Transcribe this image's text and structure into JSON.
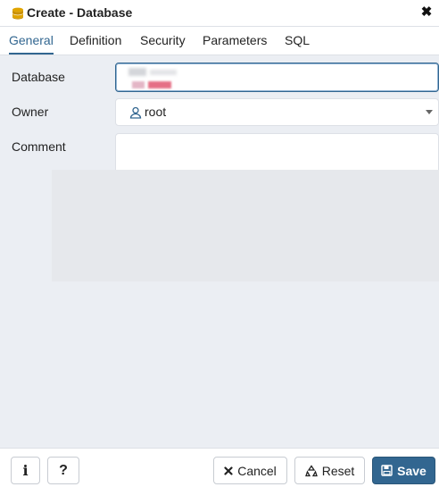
{
  "dialog": {
    "title": "Create - Database",
    "close_glyph": "✖",
    "title_icon": "database-icon"
  },
  "tabs": [
    {
      "label": "General",
      "active": true
    },
    {
      "label": "Definition",
      "active": false
    },
    {
      "label": "Security",
      "active": false
    },
    {
      "label": "Parameters",
      "active": false
    },
    {
      "label": "SQL",
      "active": false
    }
  ],
  "form": {
    "database_label": "Database",
    "database_value": "",
    "owner_label": "Owner",
    "owner_value": "root",
    "owner_icon": "user-role-icon",
    "comment_label": "Comment",
    "comment_value": ""
  },
  "footer": {
    "info_glyph": "i",
    "help_glyph": "?",
    "cancel_label": "Cancel",
    "reset_label": "Reset",
    "save_label": "Save"
  },
  "colors": {
    "accent": "#326690",
    "background": "#ebeef3",
    "db_icon": "#e0a400"
  }
}
